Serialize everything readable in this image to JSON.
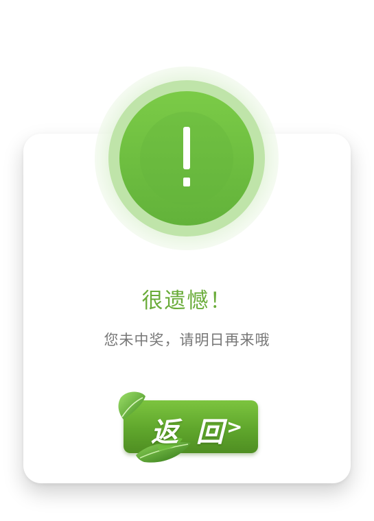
{
  "dialog": {
    "icon": "exclamation-icon",
    "title": "很遗憾！",
    "message": "您未中奖，请明日再来哦",
    "return_label": "返 回",
    "return_arrow": ">"
  },
  "colors": {
    "accent": "#6aac3a",
    "button_green": "#5fa62c",
    "text_gray": "#777777"
  }
}
